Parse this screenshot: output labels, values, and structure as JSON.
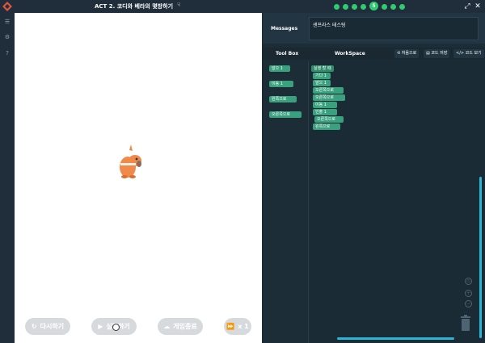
{
  "topbar": {
    "title": "ACT 2. 코디와 베라의 몇방하기",
    "progress": {
      "total": 8,
      "current": 5,
      "current_label": "5"
    }
  },
  "stage": {
    "controls": {
      "retry": "다시하기",
      "run": "실행하기",
      "end": "게임종료",
      "speed": "x 1"
    }
  },
  "messages": {
    "label": "Messages",
    "text": "샌프라스 테스팅"
  },
  "workspace": {
    "toolbox_title": "Tool Box",
    "workspace_title": "WorkSpace",
    "buttons": {
      "reset": "처음으로",
      "save": "코드 저장",
      "view": "코드 보기"
    }
  },
  "toolbox_blocks": [
    "앞으 1",
    "이동 1",
    "왼쪽으로",
    "오른쪽으로"
  ],
  "code_blocks": [
    {
      "label": "실행 할 때",
      "start": true
    },
    {
      "label": "기다 1"
    },
    {
      "label": "앞으 1"
    },
    {
      "label": "오른쪽으로"
    },
    {
      "label": "오른쪽으로"
    },
    {
      "label": "이동 1"
    },
    {
      "label": "인출 1"
    },
    {
      "label": "오른쪽으로"
    },
    {
      "label": "왼쪽으로"
    }
  ],
  "colors": {
    "block": "#3aa17e",
    "accent": "#2bb5d6",
    "progress": "#2ecc71"
  }
}
